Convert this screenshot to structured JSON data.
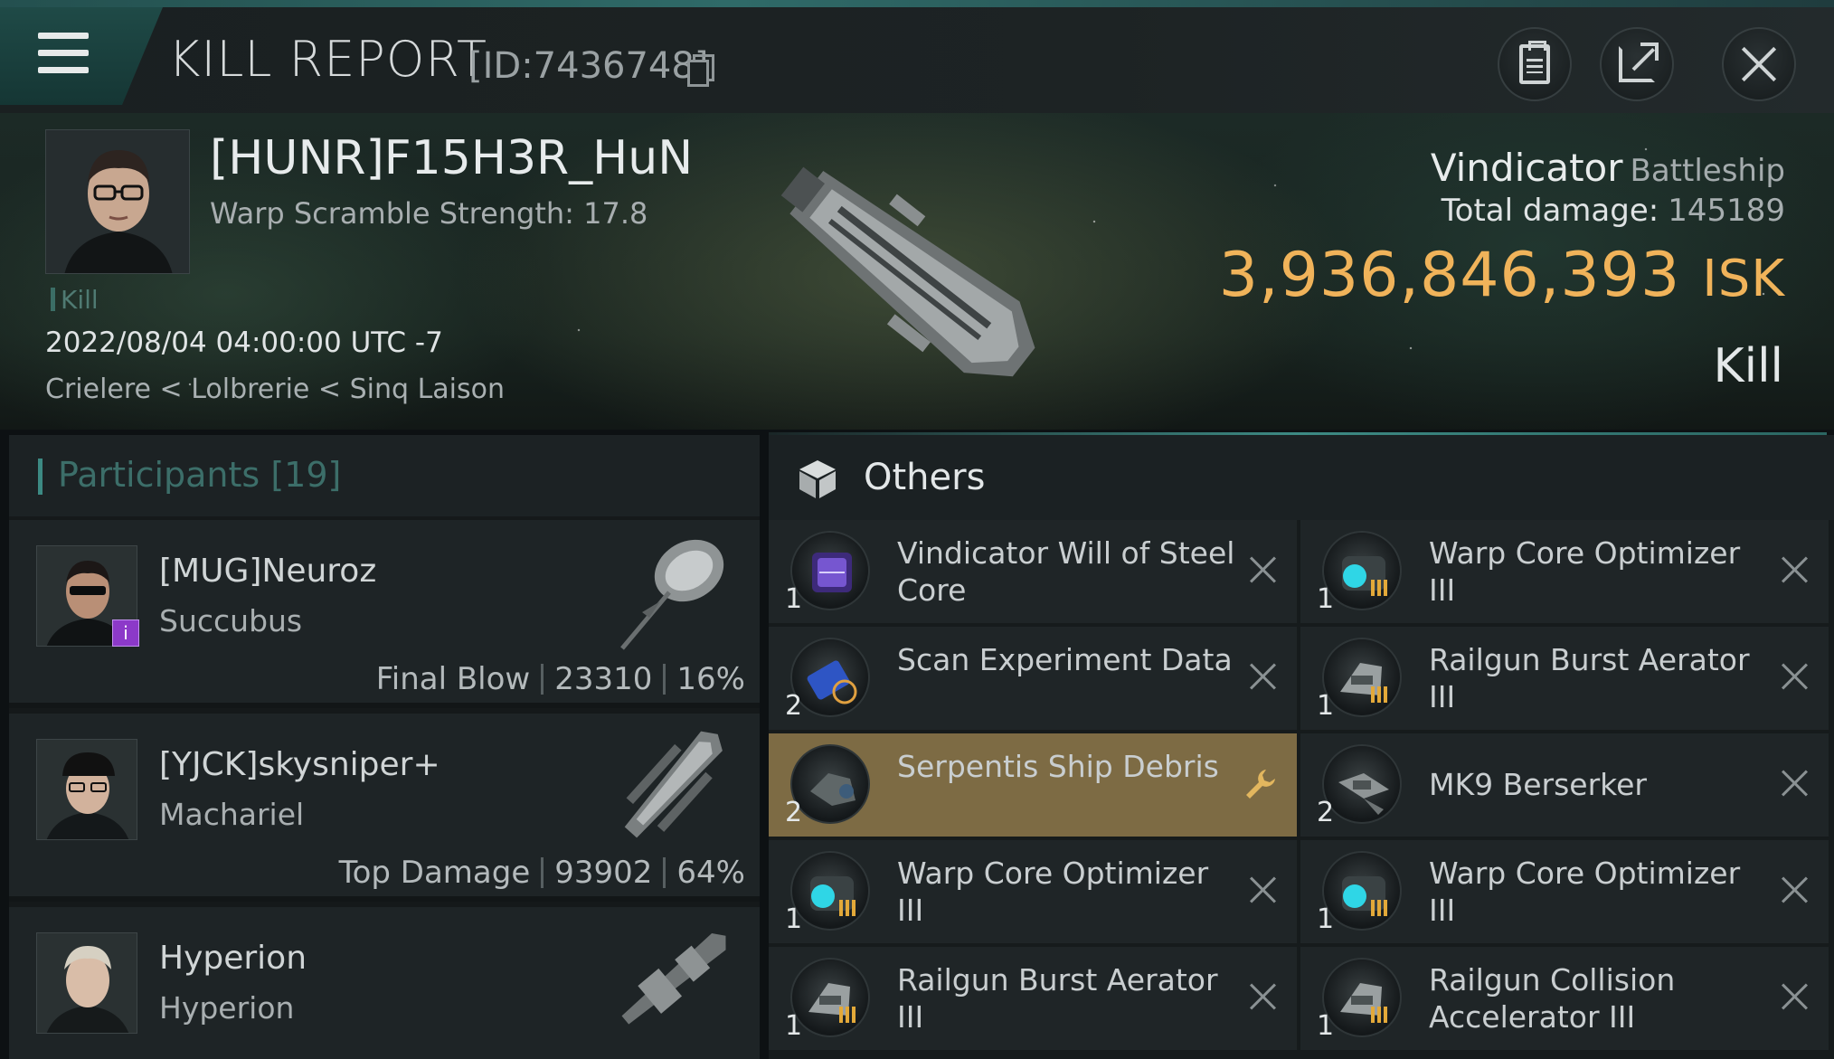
{
  "window": {
    "title": "KILL REPORT",
    "report_id": "[ID:7436748]"
  },
  "victim": {
    "name": "[HUNR]F15H3R_HuN",
    "subtitle": "Warp Scramble Strength: 17.8",
    "tag": "Kill",
    "datetime": "2022/08/04 04:00:00 UTC -7",
    "location": "Crielere < Lolbrerie < Sinq Laison",
    "ship_name": "Vindicator",
    "ship_class": "Battleship",
    "total_damage_label": "Total damage:",
    "total_damage": "145189",
    "isk_value": "3,936,846,393",
    "isk_unit": "ISK",
    "result": "Kill"
  },
  "participants": {
    "label": "Participants",
    "count": "[19]",
    "rows": [
      {
        "name": "[MUG]Neuroz",
        "ship": "Succubus",
        "role": "Final Blow",
        "damage": "23310",
        "percent": "16%",
        "badge": "i"
      },
      {
        "name": "[YJCK]skysniper+",
        "ship": "Machariel",
        "role": "Top Damage",
        "damage": "93902",
        "percent": "64%"
      },
      {
        "name": "Hyperion",
        "ship": "Hyperion"
      }
    ]
  },
  "items": {
    "section_label": "Others",
    "left": [
      {
        "qty": "1",
        "name": "Vindicator Will of Steel Core",
        "icon": "core-icon"
      },
      {
        "qty": "2",
        "name": "Scan Experiment Data",
        "icon": "data-icon"
      },
      {
        "qty": "2",
        "name": "Serpentis Ship Debris",
        "icon": "debris-icon",
        "highlight": true
      },
      {
        "qty": "1",
        "name": "Warp Core Optimizer III",
        "icon": "module-icon"
      },
      {
        "qty": "1",
        "name": "Railgun Burst Aerator III",
        "icon": "module-icon"
      }
    ],
    "right": [
      {
        "qty": "1",
        "name": "Warp Core Optimizer III",
        "icon": "module-icon"
      },
      {
        "qty": "1",
        "name": "Railgun Burst Aerator III",
        "icon": "module-icon"
      },
      {
        "qty": "2",
        "name": "MK9  Berserker",
        "icon": "drone-icon"
      },
      {
        "qty": "1",
        "name": "Warp Core Optimizer III",
        "icon": "module-icon"
      },
      {
        "qty": "1",
        "name": "Railgun Collision Accelerator III",
        "icon": "module-icon"
      }
    ]
  },
  "colors": {
    "accent": "#3c8a83",
    "isk": "#f0b35a",
    "highlight_row": "#7d6b44"
  }
}
